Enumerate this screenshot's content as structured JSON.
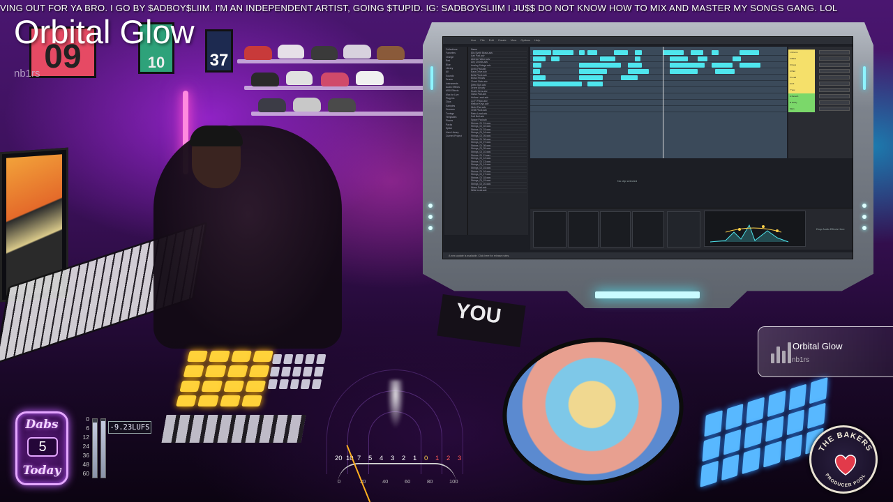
{
  "ticker": {
    "text": "VING OUT FOR YA BRO. I GO BY $ADBOY$LIIM. I'M AN INDEPENDENT ARTIST, GOING $TUPID. IG: SADBOYSLIIM I JU$$ DO NOT KNOW HOW TO MIX AND MASTER MY SONGS GANG. LOL"
  },
  "stream": {
    "title": "Orbital Glow",
    "artist": "nb1rs"
  },
  "now_playing": {
    "title": "Orbital Glow",
    "artist": "nb1rs"
  },
  "dabs_badge": {
    "top": "Dabs",
    "count": "5",
    "bottom": "Today"
  },
  "loudness_meter": {
    "readout": "-9.23LUFS",
    "scale": [
      "0",
      "6",
      "12",
      "24",
      "36",
      "48",
      "60"
    ],
    "left_level": 0.94,
    "right_level": 0.96
  },
  "vu_meter": {
    "top_scale": [
      "20",
      "10",
      "7",
      "5",
      "4",
      "3",
      "2",
      "1",
      "0",
      "1",
      "2",
      "3"
    ],
    "bottom_scale": [
      "0",
      "20",
      "40",
      "60",
      "80",
      "100"
    ]
  },
  "studio_decor": {
    "frame_numbers": [
      "09",
      "10",
      "37"
    ],
    "sticker_text": "YOU"
  },
  "daw": {
    "menu": [
      "Live",
      "File",
      "Edit",
      "Create",
      "View",
      "Options",
      "Help"
    ],
    "places": [
      "Collections",
      "Favorites",
      "Orange",
      "Red",
      "Blue",
      "Library",
      "All",
      "Sounds",
      "Drums",
      "Instruments",
      "Audio Effects",
      "MIDI Effects",
      "Max for Live",
      "Plug-Ins",
      "Clips",
      "Samples",
      "Grooves",
      "Tunings",
      "Templates",
      "Places",
      "Packs",
      "Splice",
      "User Library",
      "Current Project"
    ],
    "files": [
      "Name",
      "80s Synth Brass.adv",
      "Aah Pad.adv",
      "Ableton Wave.adv",
      "Airy Chords.adv",
      "Analog Strings.adv",
      "Arctic Pad.adv",
      "Bass Drive.adv",
      "Bells Pluck.adv",
      "Brass Hit.adv",
      "Chord Stab.adv",
      "Deep Sub.adv",
      "Drone Air.adv",
      "Dusty Keys.adv",
      "Glass Pad.adv",
      "Hollow Lead.adv",
      "Lo-Fi Piano.adv",
      "Mellow Keys.adv",
      "Night Pad.adv",
      "Orbit Pluck.adv",
      "Retro Lead.adv",
      "Soft Bell.adv",
      "Space Pad.adv",
      "Strings_Dl_01.wav",
      "Strings_Dl_02.wav",
      "Strings_Dl_03.wav",
      "Strings_Dl_04.wav",
      "Strings_Dl_05.wav",
      "Strings_Dl_06.wav",
      "Strings_Dl_07.wav",
      "Strings_Dl_08.wav",
      "Strings_Dl_09.wav",
      "Strings_Dl_10.wav",
      "Strings_Dl_11.wav",
      "Strings_Dl_12.wav",
      "Strings_Dl_13.wav",
      "Strings_Dl_14.wav",
      "Strings_Dl_15.wav",
      "Strings_Dl_16.wav",
      "Strings_Dl_17.wav",
      "Strings_Dl_18.wav",
      "Strings_Dl_19.wav",
      "Strings_Dl_20.wav",
      "Warm Pad.adv",
      "Wide Lead.adv"
    ],
    "tracks": [
      "1 Drums",
      "2 Bass",
      "3 Keys",
      "4 Pad",
      "5 Lead",
      "6 FX",
      "7 Vox",
      "A Reverb",
      "B Delay",
      "Main"
    ],
    "no_clip_message": "No clip selected",
    "drop_effects_hint": "Drop Audio Effects Here",
    "status_text": "A new update is available. Click here for release notes.",
    "colors": {
      "clip": "#4fe6ee",
      "track_header_yellow": "#f5e06a",
      "track_header_green": "#7bd86a",
      "arrangement_bg": "#3b4a5a"
    }
  },
  "logo": {
    "top_text": "THE BAKERS",
    "bottom_text": "PRODUCER POOL"
  },
  "icons": {
    "now_playing": "audio-bars-icon",
    "logo": "heart-logo-icon"
  }
}
